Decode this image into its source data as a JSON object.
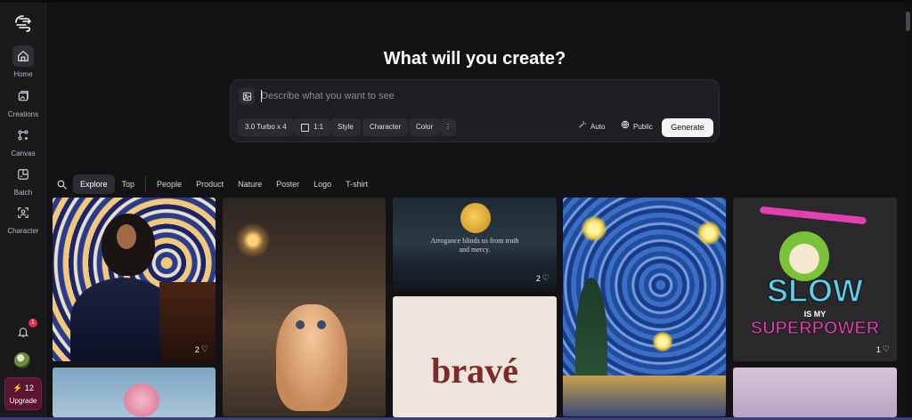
{
  "headline": "What will you create?",
  "prompt": {
    "placeholder": "Describe what you want to see",
    "model_chip": "3.0 Turbo x 4",
    "ratio_chip": "1:1",
    "style_chip": "Style",
    "character_chip": "Character",
    "color_chip": "Color",
    "auto_label": "Auto",
    "visibility_label": "Public",
    "generate_label": "Generate"
  },
  "sidebar": {
    "items": [
      {
        "label": "Home",
        "icon": "home-icon"
      },
      {
        "label": "Creations",
        "icon": "images-icon"
      },
      {
        "label": "Canvas",
        "icon": "canvas-icon"
      },
      {
        "label": "Batch",
        "icon": "batch-icon"
      },
      {
        "label": "Character",
        "icon": "character-icon"
      }
    ],
    "notification_count": "1",
    "credits": "12",
    "upgrade_label": "Upgrade"
  },
  "filters": {
    "tabs": [
      "Explore",
      "Top",
      "People",
      "Product",
      "Nature",
      "Poster",
      "Logo",
      "T-shirt"
    ],
    "active": "Explore"
  },
  "gallery": {
    "pianist_likes": "2",
    "moon_likes": "2",
    "sloth_likes": "1",
    "moon_text": "Arrogance blinds us from truth and mercy.",
    "brave_text": "bravé",
    "sloth_text_1": "SLOW",
    "sloth_text_2": "IS MY",
    "sloth_text_3": "SUPERPOWER"
  },
  "colors": {
    "background": "#131316",
    "sidebar": "#1a1a1d",
    "accent_upgrade": "#5a1530",
    "badge": "#e0304a",
    "generate_button": "#f4f4f5"
  }
}
